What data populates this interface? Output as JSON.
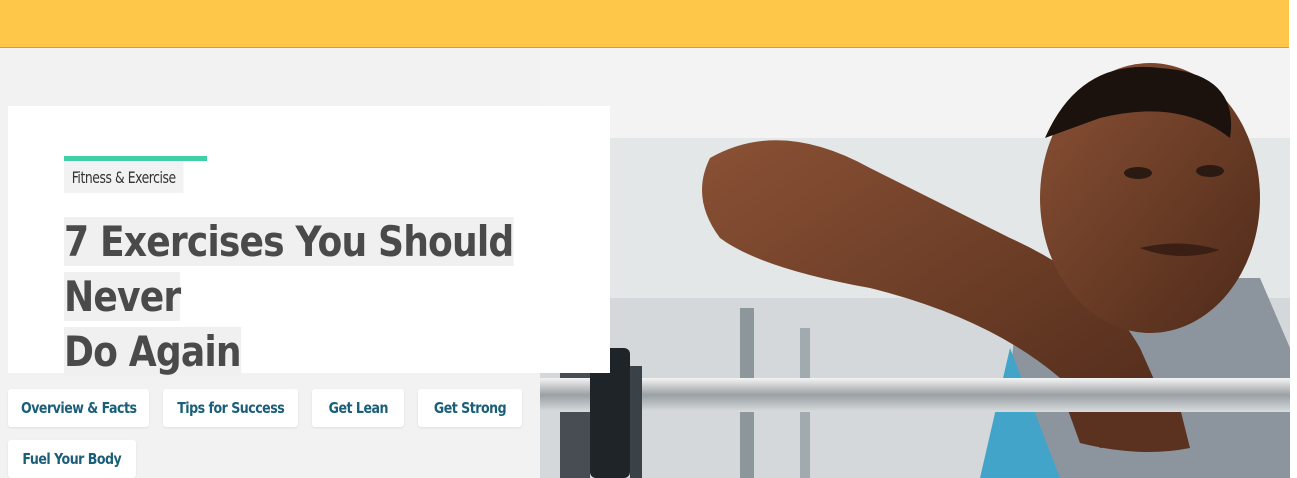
{
  "colors": {
    "header_bar": "#fec74a",
    "category_accent": "#3fd0a6",
    "nav_text": "#1a5e7a",
    "title_text": "#4a4a4a"
  },
  "article": {
    "category": "Fitness & Exercise",
    "title_line1": "7 Exercises You Should Never",
    "title_line2": "Do Again"
  },
  "nav": {
    "items": [
      {
        "label": "Overview & Facts"
      },
      {
        "label": "Tips for Success"
      },
      {
        "label": "Get Lean"
      },
      {
        "label": "Get Strong"
      },
      {
        "label": "Fuel Your Body"
      }
    ]
  },
  "hero": {
    "image_subject": "man-resting-on-barbell-photo"
  }
}
